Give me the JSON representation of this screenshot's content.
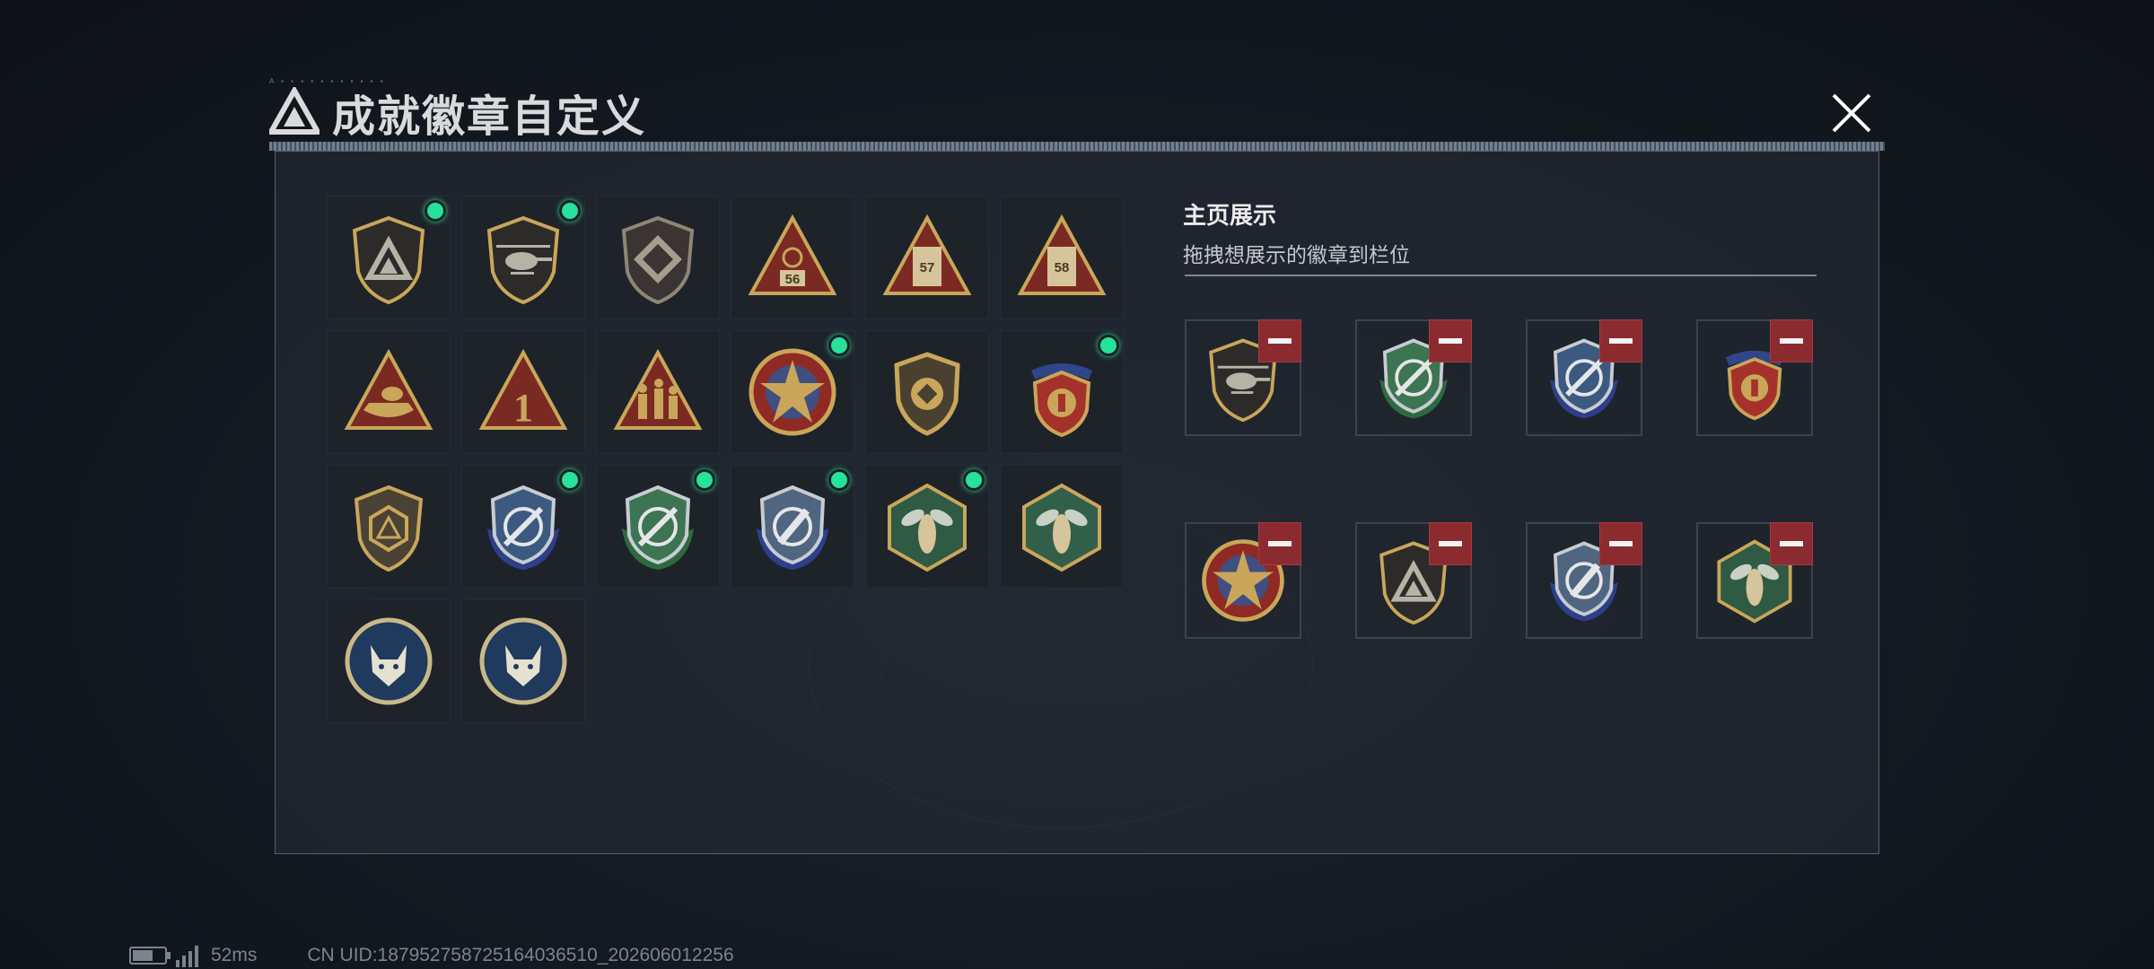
{
  "title": "成就徽章自定义",
  "title_deco": "A ▪ ▪ ▪ ▪ ▪ ▪ ▪ ▪ ▪ ▪ ▪",
  "side": {
    "title": "主页展示",
    "subtitle": "拖拽想展示的徽章到栏位"
  },
  "badges": [
    {
      "icon": "shield-delta-logo-icon",
      "selected": true
    },
    {
      "icon": "helicopter-shield-icon",
      "selected": true
    },
    {
      "icon": "diamond-shield-icon",
      "selected": false
    },
    {
      "icon": "triangle-56-icon",
      "label": "56",
      "selected": false
    },
    {
      "icon": "triangle-57-icon",
      "label": "57",
      "selected": false
    },
    {
      "icon": "triangle-58-icon",
      "label": "58",
      "selected": false
    },
    {
      "icon": "triangle-boat-icon",
      "selected": false
    },
    {
      "icon": "triangle-number-1-icon",
      "label": "1",
      "selected": false
    },
    {
      "icon": "triangle-soldiers-icon",
      "selected": false
    },
    {
      "icon": "star-medal-icon",
      "selected": true
    },
    {
      "icon": "gold-crest-icon",
      "selected": false
    },
    {
      "icon": "laurel-crest-icon",
      "selected": true
    },
    {
      "icon": "d20-shield-icon",
      "selected": false
    },
    {
      "icon": "blue-crosshair-crest-icon",
      "selected": true
    },
    {
      "icon": "green-crosshair-crest-icon",
      "selected": true
    },
    {
      "icon": "blue-crosshair-crest-alt-icon",
      "selected": true
    },
    {
      "icon": "wasp-hexagon-icon",
      "selected": true
    },
    {
      "icon": "wasp-hexagon-alt-icon",
      "selected": false
    },
    {
      "icon": "wolf-emblem-icon",
      "selected": false
    },
    {
      "icon": "wolf-emblem-alt-icon",
      "selected": false
    }
  ],
  "slots": [
    {
      "icon": "helicopter-shield-icon"
    },
    {
      "icon": "green-crosshair-crest-icon"
    },
    {
      "icon": "blue-crosshair-crest-icon"
    },
    {
      "icon": "laurel-crest-icon"
    },
    {
      "icon": "star-medal-icon"
    },
    {
      "icon": "shield-delta-logo-icon"
    },
    {
      "icon": "blue-crosshair-crest-alt-icon"
    },
    {
      "icon": "wasp-hexagon-icon"
    }
  ],
  "status": {
    "ping": "52ms",
    "uid": "CN UID:18795275872516403​6510_202606012256"
  },
  "colors": {
    "selected_dot": "#27e29a",
    "remove_button": "#8b2b30",
    "gold": "#c9a65a"
  }
}
